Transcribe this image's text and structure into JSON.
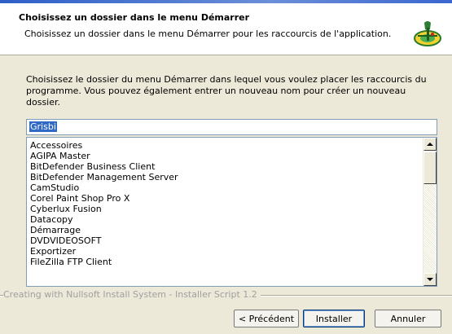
{
  "header": {
    "title": "Choisissez un dossier dans le menu Démarrer",
    "subtitle": "Choisissez un dossier dans le menu Démarrer pour les raccourcis de l'application."
  },
  "intro": {
    "text": "Choisissez le dossier du menu Démarrer dans lequel vous voulez placer les raccourcis du programme. Vous pouvez également entrer un nouveau nom pour créer un nouveau dossier."
  },
  "folder_input": {
    "value": "Grisbi"
  },
  "folder_list": {
    "items": [
      "Accessoires",
      "AGIPA Master",
      "BitDefender Business Client",
      "BitDefender Management Server",
      "CamStudio",
      "Corel Paint Shop Pro X",
      "Cyberlux Fusion",
      "Datacopy",
      "Démarrage",
      "DVDVIDEOSOFT",
      "Exportizer",
      "FileZilla FTP Client"
    ]
  },
  "branding": {
    "text": "Creating with Nullsoft Install System - Installer Script 1.2"
  },
  "buttons": {
    "back": "< Précédent",
    "install": "Installer",
    "cancel": "Annuler"
  }
}
